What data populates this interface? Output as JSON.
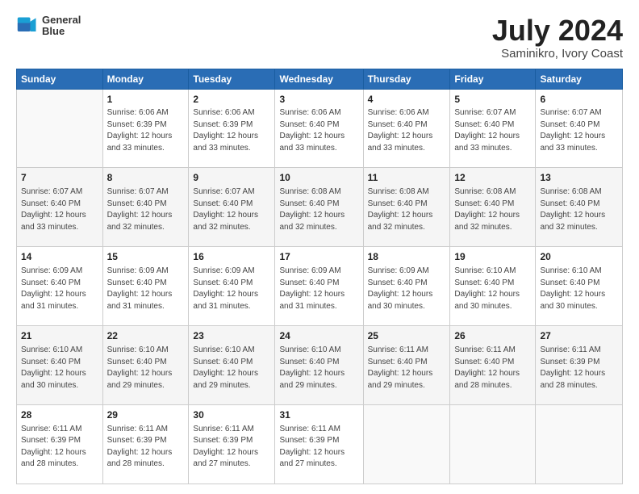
{
  "logo": {
    "line1": "General",
    "line2": "Blue"
  },
  "title": "July 2024",
  "location": "Saminikro, Ivory Coast",
  "weekdays": [
    "Sunday",
    "Monday",
    "Tuesday",
    "Wednesday",
    "Thursday",
    "Friday",
    "Saturday"
  ],
  "weeks": [
    [
      {
        "day": "",
        "info": ""
      },
      {
        "day": "1",
        "info": "Sunrise: 6:06 AM\nSunset: 6:39 PM\nDaylight: 12 hours\nand 33 minutes."
      },
      {
        "day": "2",
        "info": "Sunrise: 6:06 AM\nSunset: 6:39 PM\nDaylight: 12 hours\nand 33 minutes."
      },
      {
        "day": "3",
        "info": "Sunrise: 6:06 AM\nSunset: 6:40 PM\nDaylight: 12 hours\nand 33 minutes."
      },
      {
        "day": "4",
        "info": "Sunrise: 6:06 AM\nSunset: 6:40 PM\nDaylight: 12 hours\nand 33 minutes."
      },
      {
        "day": "5",
        "info": "Sunrise: 6:07 AM\nSunset: 6:40 PM\nDaylight: 12 hours\nand 33 minutes."
      },
      {
        "day": "6",
        "info": "Sunrise: 6:07 AM\nSunset: 6:40 PM\nDaylight: 12 hours\nand 33 minutes."
      }
    ],
    [
      {
        "day": "7",
        "info": "Sunrise: 6:07 AM\nSunset: 6:40 PM\nDaylight: 12 hours\nand 33 minutes."
      },
      {
        "day": "8",
        "info": "Sunrise: 6:07 AM\nSunset: 6:40 PM\nDaylight: 12 hours\nand 32 minutes."
      },
      {
        "day": "9",
        "info": "Sunrise: 6:07 AM\nSunset: 6:40 PM\nDaylight: 12 hours\nand 32 minutes."
      },
      {
        "day": "10",
        "info": "Sunrise: 6:08 AM\nSunset: 6:40 PM\nDaylight: 12 hours\nand 32 minutes."
      },
      {
        "day": "11",
        "info": "Sunrise: 6:08 AM\nSunset: 6:40 PM\nDaylight: 12 hours\nand 32 minutes."
      },
      {
        "day": "12",
        "info": "Sunrise: 6:08 AM\nSunset: 6:40 PM\nDaylight: 12 hours\nand 32 minutes."
      },
      {
        "day": "13",
        "info": "Sunrise: 6:08 AM\nSunset: 6:40 PM\nDaylight: 12 hours\nand 32 minutes."
      }
    ],
    [
      {
        "day": "14",
        "info": "Sunrise: 6:09 AM\nSunset: 6:40 PM\nDaylight: 12 hours\nand 31 minutes."
      },
      {
        "day": "15",
        "info": "Sunrise: 6:09 AM\nSunset: 6:40 PM\nDaylight: 12 hours\nand 31 minutes."
      },
      {
        "day": "16",
        "info": "Sunrise: 6:09 AM\nSunset: 6:40 PM\nDaylight: 12 hours\nand 31 minutes."
      },
      {
        "day": "17",
        "info": "Sunrise: 6:09 AM\nSunset: 6:40 PM\nDaylight: 12 hours\nand 31 minutes."
      },
      {
        "day": "18",
        "info": "Sunrise: 6:09 AM\nSunset: 6:40 PM\nDaylight: 12 hours\nand 30 minutes."
      },
      {
        "day": "19",
        "info": "Sunrise: 6:10 AM\nSunset: 6:40 PM\nDaylight: 12 hours\nand 30 minutes."
      },
      {
        "day": "20",
        "info": "Sunrise: 6:10 AM\nSunset: 6:40 PM\nDaylight: 12 hours\nand 30 minutes."
      }
    ],
    [
      {
        "day": "21",
        "info": "Sunrise: 6:10 AM\nSunset: 6:40 PM\nDaylight: 12 hours\nand 30 minutes."
      },
      {
        "day": "22",
        "info": "Sunrise: 6:10 AM\nSunset: 6:40 PM\nDaylight: 12 hours\nand 29 minutes."
      },
      {
        "day": "23",
        "info": "Sunrise: 6:10 AM\nSunset: 6:40 PM\nDaylight: 12 hours\nand 29 minutes."
      },
      {
        "day": "24",
        "info": "Sunrise: 6:10 AM\nSunset: 6:40 PM\nDaylight: 12 hours\nand 29 minutes."
      },
      {
        "day": "25",
        "info": "Sunrise: 6:11 AM\nSunset: 6:40 PM\nDaylight: 12 hours\nand 29 minutes."
      },
      {
        "day": "26",
        "info": "Sunrise: 6:11 AM\nSunset: 6:40 PM\nDaylight: 12 hours\nand 28 minutes."
      },
      {
        "day": "27",
        "info": "Sunrise: 6:11 AM\nSunset: 6:39 PM\nDaylight: 12 hours\nand 28 minutes."
      }
    ],
    [
      {
        "day": "28",
        "info": "Sunrise: 6:11 AM\nSunset: 6:39 PM\nDaylight: 12 hours\nand 28 minutes."
      },
      {
        "day": "29",
        "info": "Sunrise: 6:11 AM\nSunset: 6:39 PM\nDaylight: 12 hours\nand 28 minutes."
      },
      {
        "day": "30",
        "info": "Sunrise: 6:11 AM\nSunset: 6:39 PM\nDaylight: 12 hours\nand 27 minutes."
      },
      {
        "day": "31",
        "info": "Sunrise: 6:11 AM\nSunset: 6:39 PM\nDaylight: 12 hours\nand 27 minutes."
      },
      {
        "day": "",
        "info": ""
      },
      {
        "day": "",
        "info": ""
      },
      {
        "day": "",
        "info": ""
      }
    ]
  ]
}
